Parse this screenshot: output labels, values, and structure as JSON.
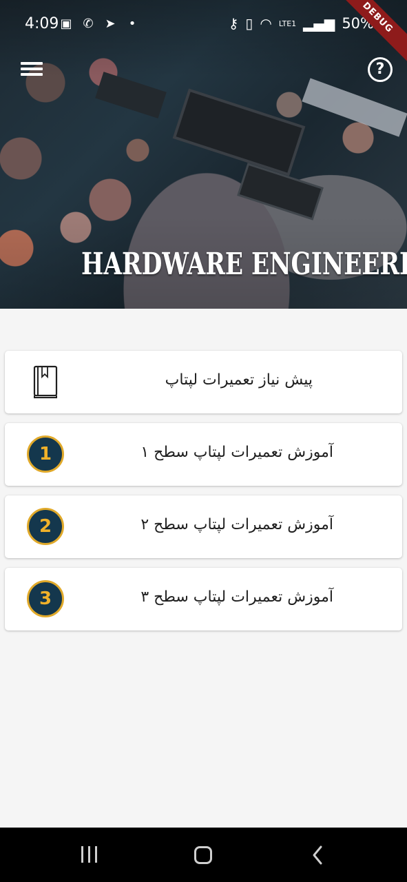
{
  "status_bar": {
    "time": "4:09",
    "network": "LTE1",
    "battery": "50%",
    "debug_label": "DEBUG"
  },
  "header": {
    "title": "HARDWARE ENGINEERING",
    "menu_icon": "hamburger-menu-icon",
    "help_icon": "question-circle-icon",
    "help_glyph": "?"
  },
  "menu": {
    "items": [
      {
        "label": "پیش نیاز تعمیرات لپتاپ",
        "icon": "book-icon"
      },
      {
        "label": "آموزش تعمیرات لپتاپ سطح ۱",
        "badge": "1"
      },
      {
        "label": "آموزش تعمیرات لپتاپ سطح ۲",
        "badge": "2"
      },
      {
        "label": "آموزش تعمیرات لپتاپ سطح ۳",
        "badge": "3"
      }
    ]
  },
  "colors": {
    "badge_fill": "#14374d",
    "badge_accent": "#e0a92a",
    "background": "#f5f5f5",
    "card": "#ffffff"
  }
}
